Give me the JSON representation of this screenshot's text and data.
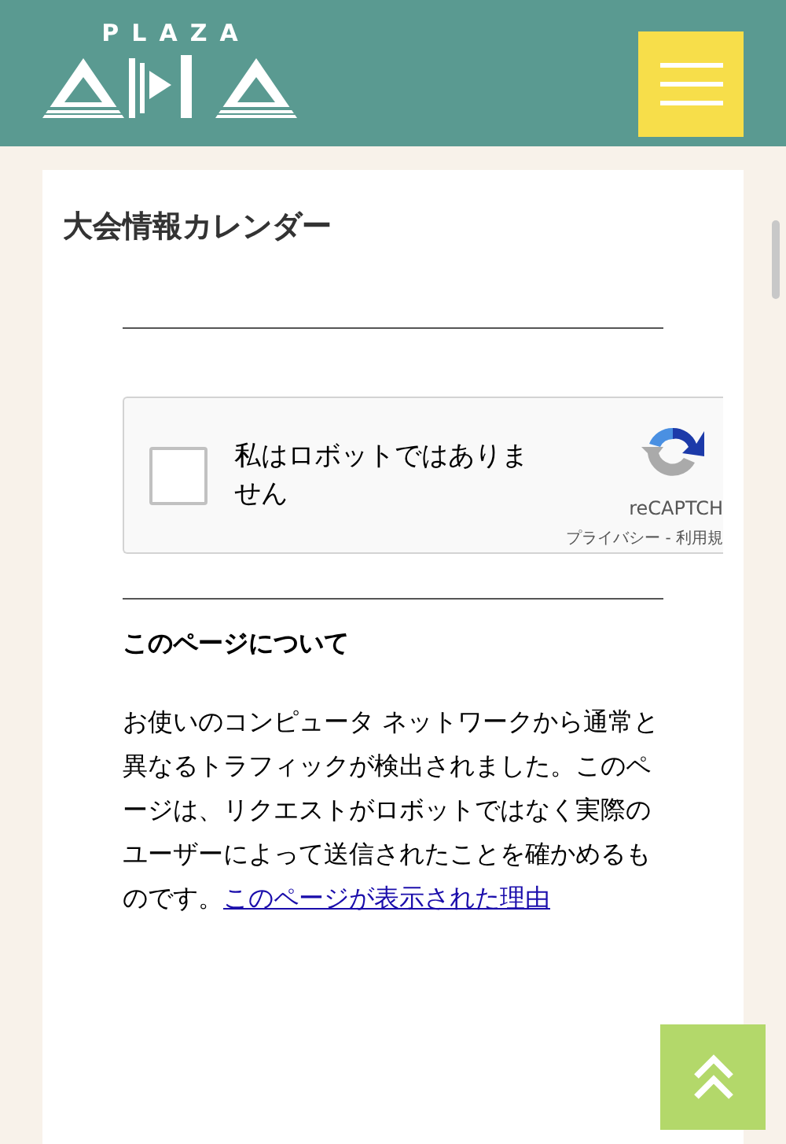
{
  "header": {
    "logo_text": "PLAZA"
  },
  "page": {
    "title": "大会情報カレンダー"
  },
  "captcha": {
    "checked": false,
    "label": "私はロボットではありません",
    "brand": "reCAPTCH",
    "links": "プライバシー - 利用規"
  },
  "about": {
    "heading": "このページについて",
    "text": "お使いのコンピュータ ネットワークから通常と異なるトラフィックが検出されました。このページは、リクエストがロボットではなく実際のユーザーによって送信されたことを確かめるものです。",
    "link": "このページが表示された理由"
  }
}
